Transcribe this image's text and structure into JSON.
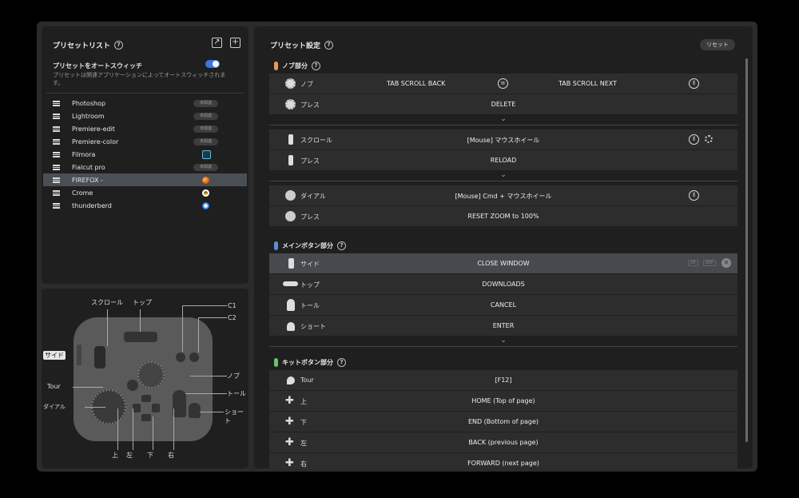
{
  "preset_list": {
    "title": "プリセットリスト",
    "help": "?",
    "export_icon": "↗",
    "add_icon": "+",
    "auto_switch_label": "プリセットをオートスウィッチ",
    "auto_switch_desc": "プリセットは関連アプリケーションによってオートスウィッチされます。",
    "items": [
      {
        "name": "Photoshop",
        "badge": "未関連"
      },
      {
        "name": "Lightroom",
        "badge": "未関連"
      },
      {
        "name": "Premiere-edit",
        "badge": "未関連"
      },
      {
        "name": "Premiere-color",
        "badge": "未関連"
      },
      {
        "name": "Filmora",
        "icon": "filmora-icon"
      },
      {
        "name": "Fialcut pro",
        "badge": "未関連"
      },
      {
        "name": "FIREFOX -",
        "icon": "firefox-icon"
      },
      {
        "name": "Crome",
        "icon": "chrome-icon"
      },
      {
        "name": "thunderberd",
        "icon": "thunderbird-icon"
      }
    ]
  },
  "device_labels": {
    "scroll": "スクロール",
    "top": "トップ",
    "c1": "C1",
    "c2": "C2",
    "side": "サイド",
    "knob": "ノブ",
    "tour": "Tour",
    "toll": "トール",
    "dial": "ダイアル",
    "short": "ショート",
    "up": "上",
    "left": "左",
    "down": "下",
    "right": "右"
  },
  "preset_settings": {
    "title": "プリセット設定",
    "help": "?",
    "reset": "リセット",
    "chevron": "⌄",
    "knob_section": {
      "title": "ノブ部分",
      "rows": [
        {
          "label": "ノブ",
          "left_action": "TAB SCROLL   BACK",
          "right_action": "TAB SCROLL   NEXT"
        },
        {
          "label": "プレス",
          "action": "DELETE"
        },
        {
          "label": "スクロール",
          "action": "[Mouse] マウスホイール"
        },
        {
          "label": "プレス",
          "action": "RELOAD"
        },
        {
          "label": "ダイアル",
          "action": "[Mouse] Cmd + マウスホイール"
        },
        {
          "label": "プレス",
          "action": "RESET ZOOM to 100%"
        }
      ]
    },
    "main_section": {
      "title": "メインボタン部分",
      "rows": [
        {
          "label": "サイド",
          "action": "CLOSE WINDOW",
          "badge_up": "UP",
          "badge_rep": "REP"
        },
        {
          "label": "トップ",
          "action": "DOWNLOADS"
        },
        {
          "label": "トール",
          "action": "CANCEL"
        },
        {
          "label": "ショート",
          "action": "ENTER"
        }
      ]
    },
    "kit_section": {
      "title": "キットボタン部分",
      "rows": [
        {
          "label": "Tour",
          "action": "[F12]"
        },
        {
          "label": "上",
          "action": "HOME (Top of page)"
        },
        {
          "label": "下",
          "action": "END (Bottom of page)"
        },
        {
          "label": "左",
          "action": "BACK (previous page)"
        },
        {
          "label": "右",
          "action": "FORWARD (next page)"
        }
      ]
    }
  },
  "colors": {
    "knob_section": "#e59a5c",
    "main_section": "#5a8fd8",
    "kit_section": "#6cc26c",
    "toggle_on": "#3d74e0"
  }
}
